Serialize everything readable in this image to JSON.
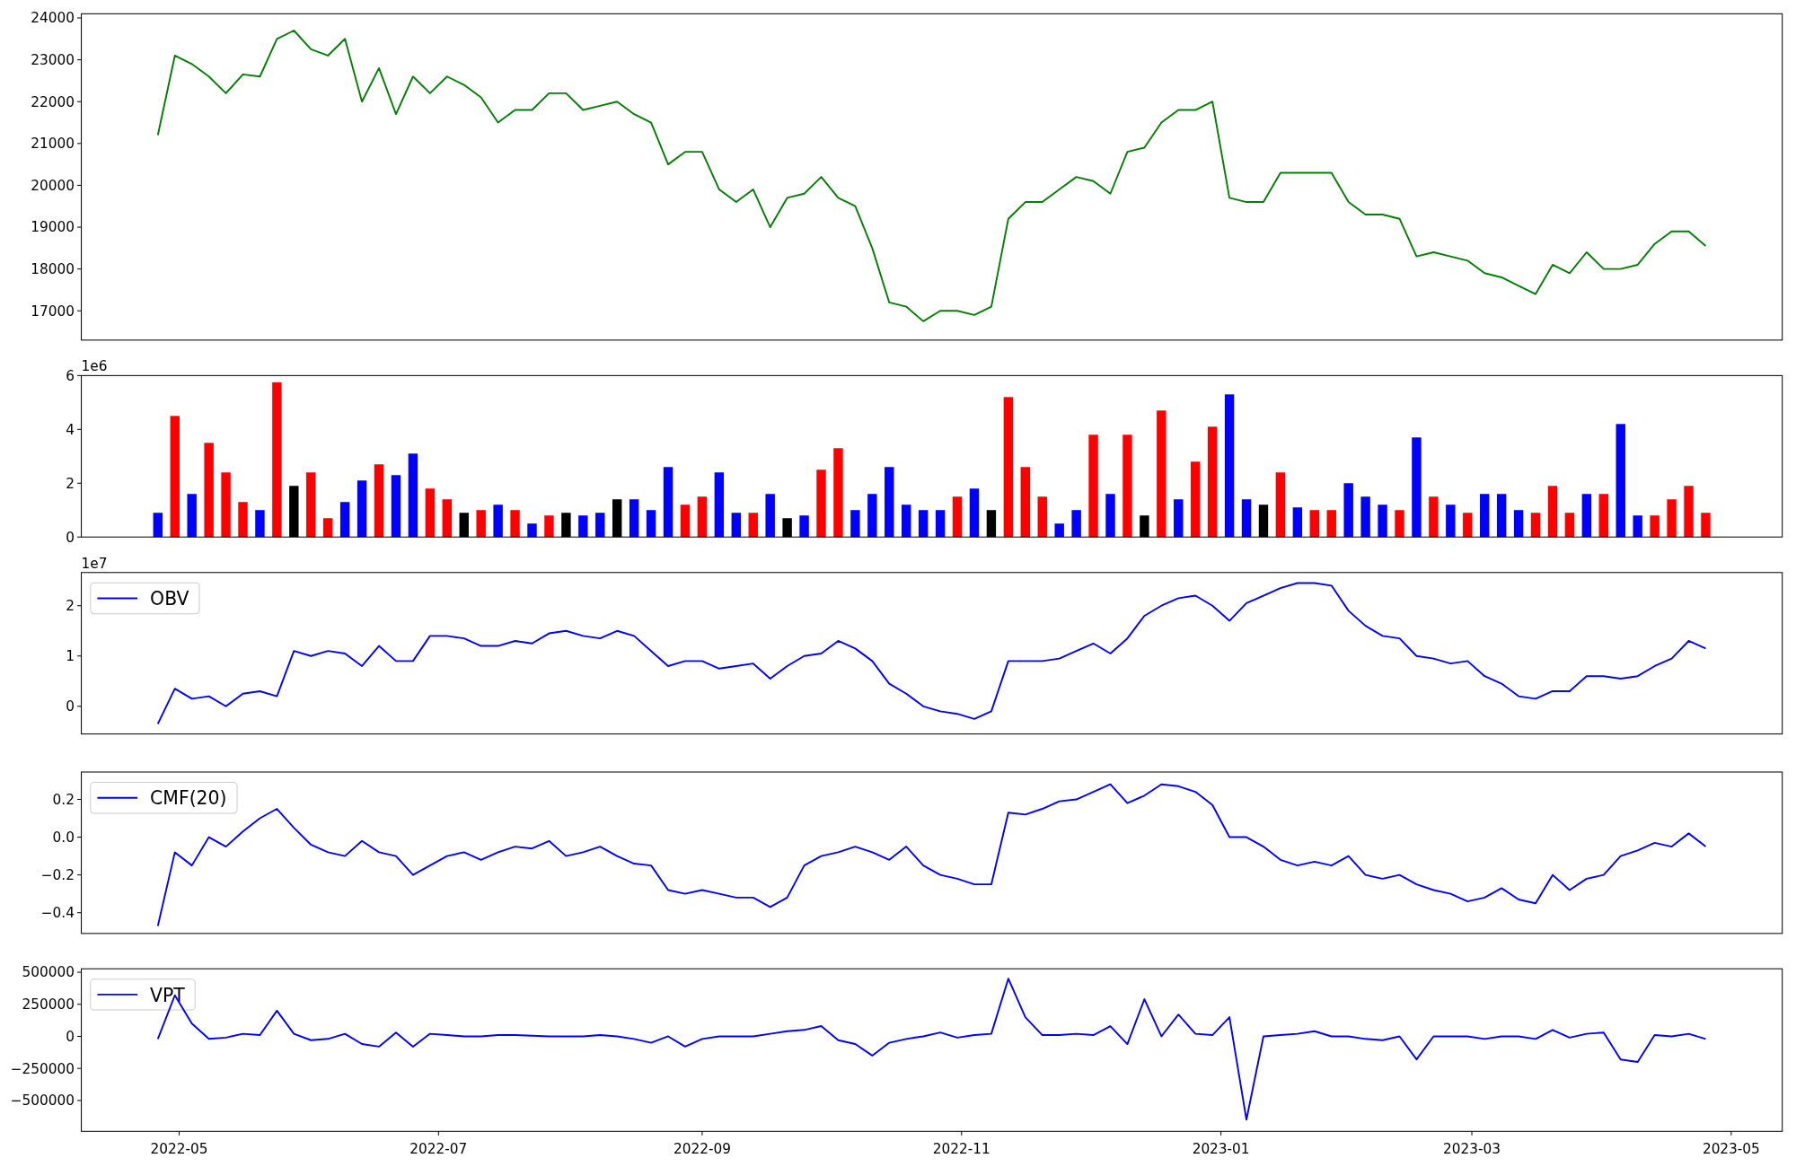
{
  "figure": {
    "panels": [
      {
        "chart_data": {
          "type": "line",
          "xlim": [
            "2022-04-08",
            "2023-05-13"
          ],
          "ylim": [
            16300,
            24100
          ],
          "yticks": [
            17000,
            18000,
            19000,
            20000,
            21000,
            22000,
            23000,
            24000
          ],
          "x": [
            "2022-04-26",
            "2022-04-30",
            "2022-05-04",
            "2022-05-08",
            "2022-05-12",
            "2022-05-16",
            "2022-05-20",
            "2022-05-24",
            "2022-05-28",
            "2022-06-01",
            "2022-06-05",
            "2022-06-09",
            "2022-06-13",
            "2022-06-17",
            "2022-06-21",
            "2022-06-25",
            "2022-06-29",
            "2022-07-03",
            "2022-07-07",
            "2022-07-11",
            "2022-07-15",
            "2022-07-19",
            "2022-07-23",
            "2022-07-27",
            "2022-07-31",
            "2022-08-04",
            "2022-08-08",
            "2022-08-12",
            "2022-08-16",
            "2022-08-20",
            "2022-08-24",
            "2022-08-28",
            "2022-09-01",
            "2022-09-05",
            "2022-09-09",
            "2022-09-13",
            "2022-09-17",
            "2022-09-21",
            "2022-09-25",
            "2022-09-29",
            "2022-10-03",
            "2022-10-07",
            "2022-10-11",
            "2022-10-15",
            "2022-10-19",
            "2022-10-23",
            "2022-10-27",
            "2022-10-31",
            "2022-11-04",
            "2022-11-08",
            "2022-11-12",
            "2022-11-16",
            "2022-11-20",
            "2022-11-24",
            "2022-11-28",
            "2022-12-02",
            "2022-12-06",
            "2022-12-10",
            "2022-12-14",
            "2022-12-18",
            "2022-12-22",
            "2022-12-26",
            "2022-12-30",
            "2023-01-03",
            "2023-01-07",
            "2023-01-11",
            "2023-01-15",
            "2023-01-19",
            "2023-01-23",
            "2023-01-27",
            "2023-01-31",
            "2023-02-04",
            "2023-02-08",
            "2023-02-12",
            "2023-02-16",
            "2023-02-20",
            "2023-02-24",
            "2023-02-28",
            "2023-03-04",
            "2023-03-08",
            "2023-03-12",
            "2023-03-16",
            "2023-03-20",
            "2023-03-24",
            "2023-03-28",
            "2023-04-01",
            "2023-04-05",
            "2023-04-09",
            "2023-04-13",
            "2023-04-17",
            "2023-04-21",
            "2023-04-25"
          ],
          "series": [
            {
              "color": "#008000",
              "values": [
                21200,
                23100,
                22900,
                22600,
                22200,
                22650,
                22600,
                23500,
                23700,
                23250,
                23100,
                23500,
                22000,
                22800,
                21700,
                22600,
                22200,
                22600,
                22400,
                22100,
                21500,
                21800,
                21800,
                22200,
                22200,
                21800,
                21900,
                22000,
                21700,
                21500,
                20500,
                20800,
                20800,
                19900,
                19600,
                19900,
                19000,
                19700,
                19800,
                20200,
                19700,
                19500,
                18500,
                17200,
                17100,
                16750,
                17000,
                17000,
                16900,
                17100,
                19200,
                19600,
                19600,
                19900,
                20200,
                20100,
                19800,
                20800,
                20900,
                21500,
                21800,
                21800,
                22000,
                19700,
                19600,
                19600,
                20300,
                20300,
                20300,
                20300,
                19600,
                19300,
                19300,
                19200,
                18300,
                18400,
                18300,
                18200,
                17900,
                17800,
                17600,
                17400,
                18100,
                17900,
                18400,
                18000,
                18000,
                18100,
                18600,
                18900,
                18900,
                18550
              ]
            }
          ]
        }
      },
      {
        "offset_text": "1e6",
        "chart_data": {
          "type": "bar",
          "xlim": [
            "2022-04-08",
            "2023-05-13"
          ],
          "ylim": [
            0,
            6
          ],
          "yticks": [
            0,
            2,
            4,
            6
          ],
          "x": [
            "2022-04-26",
            "2022-04-30",
            "2022-05-04",
            "2022-05-08",
            "2022-05-12",
            "2022-05-16",
            "2022-05-20",
            "2022-05-24",
            "2022-05-28",
            "2022-06-01",
            "2022-06-05",
            "2022-06-09",
            "2022-06-13",
            "2022-06-17",
            "2022-06-21",
            "2022-06-25",
            "2022-06-29",
            "2022-07-03",
            "2022-07-07",
            "2022-07-11",
            "2022-07-15",
            "2022-07-19",
            "2022-07-23",
            "2022-07-27",
            "2022-07-31",
            "2022-08-04",
            "2022-08-08",
            "2022-08-12",
            "2022-08-16",
            "2022-08-20",
            "2022-08-24",
            "2022-08-28",
            "2022-09-01",
            "2022-09-05",
            "2022-09-09",
            "2022-09-13",
            "2022-09-17",
            "2022-09-21",
            "2022-09-25",
            "2022-09-29",
            "2022-10-03",
            "2022-10-07",
            "2022-10-11",
            "2022-10-15",
            "2022-10-19",
            "2022-10-23",
            "2022-10-27",
            "2022-10-31",
            "2022-11-04",
            "2022-11-08",
            "2022-11-12",
            "2022-11-16",
            "2022-11-20",
            "2022-11-24",
            "2022-11-28",
            "2022-12-02",
            "2022-12-06",
            "2022-12-10",
            "2022-12-14",
            "2022-12-18",
            "2022-12-22",
            "2022-12-26",
            "2022-12-30",
            "2023-01-03",
            "2023-01-07",
            "2023-01-11",
            "2023-01-15",
            "2023-01-19",
            "2023-01-23",
            "2023-01-27",
            "2023-01-31",
            "2023-02-04",
            "2023-02-08",
            "2023-02-12",
            "2023-02-16",
            "2023-02-20",
            "2023-02-24",
            "2023-02-28",
            "2023-03-04",
            "2023-03-08",
            "2023-03-12",
            "2023-03-16",
            "2023-03-20",
            "2023-03-24",
            "2023-03-28",
            "2023-04-01",
            "2023-04-05",
            "2023-04-09",
            "2023-04-13",
            "2023-04-17",
            "2023-04-21",
            "2023-04-25"
          ],
          "series": [
            {
              "color": "#ff0000",
              "values": [
                null,
                4.5,
                null,
                3.5,
                2.4,
                1.3,
                null,
                5.75,
                null,
                2.4,
                0.7,
                null,
                null,
                2.7,
                null,
                null,
                1.8,
                1.4,
                null,
                1.0,
                null,
                1.0,
                null,
                0.8,
                null,
                null,
                null,
                null,
                null,
                null,
                null,
                1.2,
                1.5,
                null,
                null,
                0.9,
                null,
                null,
                null,
                2.5,
                3.3,
                null,
                null,
                null,
                null,
                null,
                null,
                1.5,
                null,
                null,
                5.2,
                2.6,
                1.5,
                null,
                null,
                3.8,
                null,
                3.8,
                null,
                4.7,
                null,
                2.8,
                4.1,
                null,
                null,
                null,
                2.4,
                null,
                1.0,
                1.0,
                null,
                null,
                null,
                1.0,
                null,
                1.5,
                null,
                0.9,
                null,
                null,
                null,
                0.9,
                1.9,
                0.9,
                null,
                1.6,
                null,
                null,
                0.8,
                1.4,
                1.9,
                0.9
              ]
            },
            {
              "color": "#0000ff",
              "values": [
                0.9,
                null,
                1.6,
                null,
                null,
                null,
                1.0,
                null,
                null,
                null,
                null,
                1.3,
                2.1,
                null,
                2.3,
                3.1,
                null,
                null,
                null,
                null,
                1.2,
                null,
                0.5,
                null,
                null,
                0.8,
                0.9,
                null,
                1.4,
                1.0,
                2.6,
                null,
                null,
                2.4,
                0.9,
                null,
                1.6,
                null,
                0.8,
                null,
                null,
                1.0,
                1.6,
                2.6,
                1.2,
                1.0,
                1.0,
                null,
                1.8,
                null,
                null,
                null,
                null,
                0.5,
                1.0,
                null,
                1.6,
                null,
                null,
                null,
                1.4,
                null,
                null,
                5.3,
                1.4,
                null,
                null,
                1.1,
                null,
                null,
                2.0,
                1.5,
                1.2,
                null,
                3.7,
                null,
                1.2,
                null,
                1.6,
                1.6,
                1.0,
                null,
                null,
                null,
                1.6,
                null,
                4.2,
                0.8,
                null,
                null,
                null,
                null
              ]
            },
            {
              "color": "#000000",
              "values": [
                null,
                null,
                null,
                null,
                null,
                null,
                null,
                null,
                1.9,
                null,
                null,
                null,
                null,
                null,
                null,
                null,
                null,
                null,
                0.9,
                null,
                null,
                null,
                null,
                null,
                0.9,
                null,
                null,
                1.4,
                null,
                null,
                null,
                null,
                null,
                null,
                null,
                null,
                null,
                0.7,
                null,
                null,
                null,
                null,
                null,
                null,
                null,
                null,
                null,
                null,
                null,
                1.0,
                null,
                null,
                null,
                null,
                null,
                null,
                null,
                null,
                0.8,
                null,
                null,
                null,
                null,
                null,
                null,
                1.2,
                null,
                null,
                null,
                null,
                null,
                null,
                null,
                null,
                null,
                null,
                null,
                null,
                null,
                null,
                null,
                null,
                null,
                null,
                null,
                null,
                null,
                null,
                null,
                null,
                null,
                null
              ]
            }
          ]
        }
      },
      {
        "offset_text": "1e7",
        "chart_data": {
          "type": "line",
          "xlim": [
            "2022-04-08",
            "2023-05-13"
          ],
          "ylim": [
            -0.55,
            2.66
          ],
          "yticks": [
            0,
            1,
            2
          ],
          "x": [
            "2022-04-26",
            "2022-04-30",
            "2022-05-04",
            "2022-05-08",
            "2022-05-12",
            "2022-05-16",
            "2022-05-20",
            "2022-05-24",
            "2022-05-28",
            "2022-06-01",
            "2022-06-05",
            "2022-06-09",
            "2022-06-13",
            "2022-06-17",
            "2022-06-21",
            "2022-06-25",
            "2022-06-29",
            "2022-07-03",
            "2022-07-07",
            "2022-07-11",
            "2022-07-15",
            "2022-07-19",
            "2022-07-23",
            "2022-07-27",
            "2022-07-31",
            "2022-08-04",
            "2022-08-08",
            "2022-08-12",
            "2022-08-16",
            "2022-08-20",
            "2022-08-24",
            "2022-08-28",
            "2022-09-01",
            "2022-09-05",
            "2022-09-09",
            "2022-09-13",
            "2022-09-17",
            "2022-09-21",
            "2022-09-25",
            "2022-09-29",
            "2022-10-03",
            "2022-10-07",
            "2022-10-11",
            "2022-10-15",
            "2022-10-19",
            "2022-10-23",
            "2022-10-27",
            "2022-10-31",
            "2022-11-04",
            "2022-11-08",
            "2022-11-12",
            "2022-11-16",
            "2022-11-20",
            "2022-11-24",
            "2022-11-28",
            "2022-12-02",
            "2022-12-06",
            "2022-12-10",
            "2022-12-14",
            "2022-12-18",
            "2022-12-22",
            "2022-12-26",
            "2022-12-30",
            "2023-01-03",
            "2023-01-07",
            "2023-01-11",
            "2023-01-15",
            "2023-01-19",
            "2023-01-23",
            "2023-01-27",
            "2023-01-31",
            "2023-02-04",
            "2023-02-08",
            "2023-02-12",
            "2023-02-16",
            "2023-02-20",
            "2023-02-24",
            "2023-02-28",
            "2023-03-04",
            "2023-03-08",
            "2023-03-12",
            "2023-03-16",
            "2023-03-20",
            "2023-03-24",
            "2023-03-28",
            "2023-04-01",
            "2023-04-05",
            "2023-04-09",
            "2023-04-13",
            "2023-04-17",
            "2023-04-21",
            "2023-04-25"
          ],
          "series": [
            {
              "name": "OBV",
              "color": "#0000ff",
              "values": [
                -0.35,
                0.35,
                0.15,
                0.2,
                0.0,
                0.25,
                0.3,
                0.2,
                1.1,
                1.0,
                1.1,
                1.05,
                0.8,
                1.2,
                0.9,
                0.9,
                1.4,
                1.4,
                1.35,
                1.2,
                1.2,
                1.3,
                1.25,
                1.45,
                1.5,
                1.4,
                1.35,
                1.5,
                1.4,
                1.1,
                0.8,
                0.9,
                0.9,
                0.75,
                0.8,
                0.85,
                0.55,
                0.8,
                1.0,
                1.05,
                1.3,
                1.15,
                0.9,
                0.45,
                0.25,
                0.0,
                -0.1,
                -0.15,
                -0.25,
                -0.1,
                0.9,
                0.9,
                0.9,
                0.95,
                1.1,
                1.25,
                1.05,
                1.35,
                1.8,
                2.0,
                2.15,
                2.2,
                2.0,
                1.7,
                2.05,
                2.2,
                2.35,
                2.45,
                2.45,
                2.4,
                1.9,
                1.6,
                1.4,
                1.35,
                1.0,
                0.95,
                0.85,
                0.9,
                0.6,
                0.45,
                0.2,
                0.15,
                0.3,
                0.3,
                0.6,
                0.6,
                0.55,
                0.6,
                0.8,
                0.95,
                1.3,
                1.15
              ]
            }
          ]
        }
      },
      {
        "chart_data": {
          "type": "line",
          "xlim": [
            "2022-04-08",
            "2023-05-13"
          ],
          "ylim": [
            -0.51,
            0.345
          ],
          "yticks": [
            {
              "value": -0.4,
              "label": "−0.4"
            },
            {
              "value": -0.2,
              "label": "−0.2"
            },
            {
              "value": 0,
              "label": "0.0"
            },
            {
              "value": 0.2,
              "label": "0.2"
            }
          ],
          "x": [
            "2022-04-26",
            "2022-04-30",
            "2022-05-04",
            "2022-05-08",
            "2022-05-12",
            "2022-05-16",
            "2022-05-20",
            "2022-05-24",
            "2022-05-28",
            "2022-06-01",
            "2022-06-05",
            "2022-06-09",
            "2022-06-13",
            "2022-06-17",
            "2022-06-21",
            "2022-06-25",
            "2022-06-29",
            "2022-07-03",
            "2022-07-07",
            "2022-07-11",
            "2022-07-15",
            "2022-07-19",
            "2022-07-23",
            "2022-07-27",
            "2022-07-31",
            "2022-08-04",
            "2022-08-08",
            "2022-08-12",
            "2022-08-16",
            "2022-08-20",
            "2022-08-24",
            "2022-08-28",
            "2022-09-01",
            "2022-09-05",
            "2022-09-09",
            "2022-09-13",
            "2022-09-17",
            "2022-09-21",
            "2022-09-25",
            "2022-09-29",
            "2022-10-03",
            "2022-10-07",
            "2022-10-11",
            "2022-10-15",
            "2022-10-19",
            "2022-10-23",
            "2022-10-27",
            "2022-10-31",
            "2022-11-04",
            "2022-11-08",
            "2022-11-12",
            "2022-11-16",
            "2022-11-20",
            "2022-11-24",
            "2022-11-28",
            "2022-12-02",
            "2022-12-06",
            "2022-12-10",
            "2022-12-14",
            "2022-12-18",
            "2022-12-22",
            "2022-12-26",
            "2022-12-30",
            "2023-01-03",
            "2023-01-07",
            "2023-01-11",
            "2023-01-15",
            "2023-01-19",
            "2023-01-23",
            "2023-01-27",
            "2023-01-31",
            "2023-02-04",
            "2023-02-08",
            "2023-02-12",
            "2023-02-16",
            "2023-02-20",
            "2023-02-24",
            "2023-02-28",
            "2023-03-04",
            "2023-03-08",
            "2023-03-12",
            "2023-03-16",
            "2023-03-20",
            "2023-03-24",
            "2023-03-28",
            "2023-04-01",
            "2023-04-05",
            "2023-04-09",
            "2023-04-13",
            "2023-04-17",
            "2023-04-21",
            "2023-04-25"
          ],
          "series": [
            {
              "name": "CMF(20)",
              "color": "#0000ff",
              "values": [
                -0.47,
                -0.08,
                -0.15,
                0.0,
                -0.05,
                0.03,
                0.1,
                0.15,
                0.05,
                -0.04,
                -0.08,
                -0.1,
                -0.02,
                -0.08,
                -0.1,
                -0.2,
                -0.15,
                -0.1,
                -0.08,
                -0.12,
                -0.08,
                -0.05,
                -0.06,
                -0.02,
                -0.1,
                -0.08,
                -0.05,
                -0.1,
                -0.14,
                -0.15,
                -0.28,
                -0.3,
                -0.28,
                -0.3,
                -0.32,
                -0.32,
                -0.37,
                -0.32,
                -0.15,
                -0.1,
                -0.08,
                -0.05,
                -0.08,
                -0.12,
                -0.05,
                -0.15,
                -0.2,
                -0.22,
                -0.25,
                -0.25,
                0.13,
                0.12,
                0.15,
                0.19,
                0.2,
                0.24,
                0.28,
                0.18,
                0.22,
                0.28,
                0.27,
                0.24,
                0.17,
                0.0,
                0.0,
                -0.05,
                -0.12,
                -0.15,
                -0.13,
                -0.15,
                -0.1,
                -0.2,
                -0.22,
                -0.2,
                -0.25,
                -0.28,
                -0.3,
                -0.34,
                -0.32,
                -0.27,
                -0.33,
                -0.35,
                -0.2,
                -0.28,
                -0.22,
                -0.2,
                -0.1,
                -0.07,
                -0.03,
                -0.05,
                0.02,
                -0.05
              ]
            }
          ]
        }
      },
      {
        "chart_data": {
          "type": "line",
          "xlim": [
            "2022-04-08",
            "2023-05-13"
          ],
          "ylim": [
            -741000,
            527000
          ],
          "yticks": [
            {
              "value": -500000,
              "label": "−500000"
            },
            {
              "value": -250000,
              "label": "−250000"
            },
            {
              "value": 0,
              "label": "0"
            },
            {
              "value": 250000,
              "label": "250000"
            },
            {
              "value": 500000,
              "label": "500000"
            }
          ],
          "xticks": [
            {
              "value": "2022-05-01",
              "label": "2022-05"
            },
            {
              "value": "2022-07-01",
              "label": "2022-07"
            },
            {
              "value": "2022-09-01",
              "label": "2022-09"
            },
            {
              "value": "2022-11-01",
              "label": "2022-11"
            },
            {
              "value": "2023-01-01",
              "label": "2023-01"
            },
            {
              "value": "2023-03-01",
              "label": "2023-03"
            },
            {
              "value": "2023-05-01",
              "label": "2023-05"
            }
          ],
          "x": [
            "2022-04-26",
            "2022-04-30",
            "2022-05-04",
            "2022-05-08",
            "2022-05-12",
            "2022-05-16",
            "2022-05-20",
            "2022-05-24",
            "2022-05-28",
            "2022-06-01",
            "2022-06-05",
            "2022-06-09",
            "2022-06-13",
            "2022-06-17",
            "2022-06-21",
            "2022-06-25",
            "2022-06-29",
            "2022-07-03",
            "2022-07-07",
            "2022-07-11",
            "2022-07-15",
            "2022-07-19",
            "2022-07-23",
            "2022-07-27",
            "2022-07-31",
            "2022-08-04",
            "2022-08-08",
            "2022-08-12",
            "2022-08-16",
            "2022-08-20",
            "2022-08-24",
            "2022-08-28",
            "2022-09-01",
            "2022-09-05",
            "2022-09-09",
            "2022-09-13",
            "2022-09-17",
            "2022-09-21",
            "2022-09-25",
            "2022-09-29",
            "2022-10-03",
            "2022-10-07",
            "2022-10-11",
            "2022-10-15",
            "2022-10-19",
            "2022-10-23",
            "2022-10-27",
            "2022-10-31",
            "2022-11-04",
            "2022-11-08",
            "2022-11-12",
            "2022-11-16",
            "2022-11-20",
            "2022-11-24",
            "2022-11-28",
            "2022-12-02",
            "2022-12-06",
            "2022-12-10",
            "2022-12-14",
            "2022-12-18",
            "2022-12-22",
            "2022-12-26",
            "2022-12-30",
            "2023-01-03",
            "2023-01-07",
            "2023-01-11",
            "2023-01-15",
            "2023-01-19",
            "2023-01-23",
            "2023-01-27",
            "2023-01-31",
            "2023-02-04",
            "2023-02-08",
            "2023-02-12",
            "2023-02-16",
            "2023-02-20",
            "2023-02-24",
            "2023-02-28",
            "2023-03-04",
            "2023-03-08",
            "2023-03-12",
            "2023-03-16",
            "2023-03-20",
            "2023-03-24",
            "2023-03-28",
            "2023-04-01",
            "2023-04-05",
            "2023-04-09",
            "2023-04-13",
            "2023-04-17",
            "2023-04-21",
            "2023-04-25"
          ],
          "series": [
            {
              "name": "VPT",
              "color": "#0000ff",
              "values": [
                -20000,
                320000,
                100000,
                -20000,
                -10000,
                20000,
                10000,
                200000,
                20000,
                -30000,
                -20000,
                20000,
                -60000,
                -80000,
                30000,
                -80000,
                20000,
                10000,
                0,
                0,
                10000,
                10000,
                5000,
                0,
                0,
                0,
                10000,
                0,
                -20000,
                -50000,
                0,
                -80000,
                -20000,
                0,
                0,
                0,
                20000,
                40000,
                50000,
                80000,
                -30000,
                -60000,
                -150000,
                -50000,
                -20000,
                0,
                30000,
                -10000,
                10000,
                20000,
                450000,
                150000,
                10000,
                10000,
                20000,
                10000,
                80000,
                -60000,
                290000,
                0,
                170000,
                20000,
                10000,
                150000,
                -650000,
                0,
                10000,
                20000,
                40000,
                0,
                0,
                -20000,
                -30000,
                0,
                -180000,
                0,
                0,
                0,
                -20000,
                0,
                0,
                -20000,
                50000,
                -10000,
                20000,
                30000,
                -180000,
                -200000,
                10000,
                0,
                20000,
                -20000
              ]
            }
          ]
        }
      }
    ]
  }
}
